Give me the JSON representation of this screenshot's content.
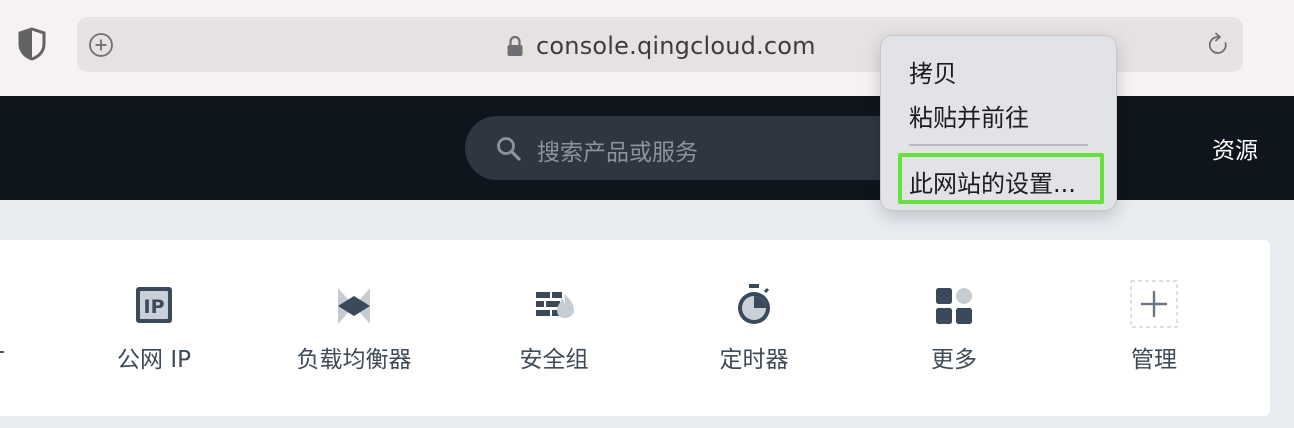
{
  "browser": {
    "url": "console.qingcloud.com",
    "icons": [
      "shield-icon",
      "add-tab-icon",
      "lock-icon",
      "reload-icon"
    ]
  },
  "header": {
    "search_placeholder": "搜索产品或服务",
    "resources_label": "资源",
    "colors": {
      "background": "#0f151d",
      "search_bg": "#2e3641"
    }
  },
  "shortcuts": [
    {
      "label": "公网 IP",
      "icon": "public-ip-icon"
    },
    {
      "label": "负载均衡器",
      "icon": "load-balancer-icon"
    },
    {
      "label": "安全组",
      "icon": "firewall-icon"
    },
    {
      "label": "定时器",
      "icon": "timer-icon"
    },
    {
      "label": "更多",
      "icon": "more-apps-icon"
    },
    {
      "label": "管理",
      "icon": "add-manage-icon"
    }
  ],
  "context_menu": {
    "items": [
      {
        "label": "拷贝"
      },
      {
        "label": "粘贴并前往"
      },
      {
        "label": "此网站的设置..."
      }
    ],
    "highlight_color": "#66e33b"
  }
}
